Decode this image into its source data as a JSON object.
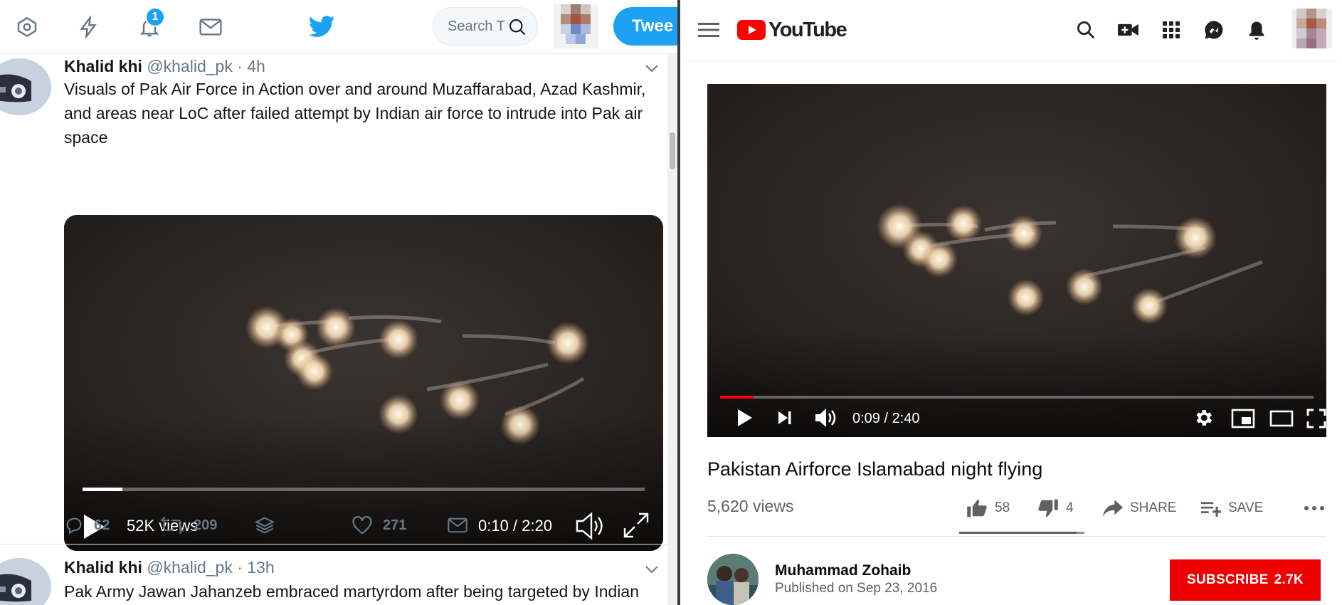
{
  "twitter": {
    "notifications_badge": "1",
    "search_placeholder": "Search Twitter",
    "search_visible": "Search T",
    "tweet_button": "Tweet",
    "tweet_button_visible": "Twee",
    "tweets": [
      {
        "name": "Khalid khi",
        "handle": "@khalid_pk",
        "time": "· 4h",
        "text": "Visuals of Pak Air Force in Action over and around Muzaffarabad, Azad Kashmir, and areas near LoC after failed attempt by Indian air force to intrude into Pak air space",
        "video": {
          "views": "52K views",
          "time": "0:10 / 2:20",
          "progress_fraction": 0.0714
        },
        "actions": {
          "replies": "62",
          "retweets": "209",
          "likes": "271"
        }
      },
      {
        "name": "Khalid khi",
        "handle": "@khalid_pk",
        "time": "· 13h",
        "text": "Pak  Army Jawan Jahanzeb embraced martyrdom after being targeted by Indian"
      }
    ]
  },
  "youtube": {
    "logo_text": "YouTube",
    "player": {
      "time": "0:09 / 2:40",
      "progress_fraction": 0.0563
    },
    "title": "Pakistan Airforce Islamabad night flying",
    "views": "5,620 views",
    "likes": "58",
    "dislikes": "4",
    "like_fraction": 0.935,
    "share_label": "SHARE",
    "save_label": "SAVE",
    "channel_name": "Muhammad Zohaib",
    "published": "Published on Sep 23, 2016",
    "subscribe_label": "SUBSCRIBE",
    "subscriber_count": "2.7K"
  },
  "colors": {
    "twitter_blue": "#1da1f2",
    "youtube_red": "#ff0000",
    "subscribe_red": "#ee0000"
  }
}
